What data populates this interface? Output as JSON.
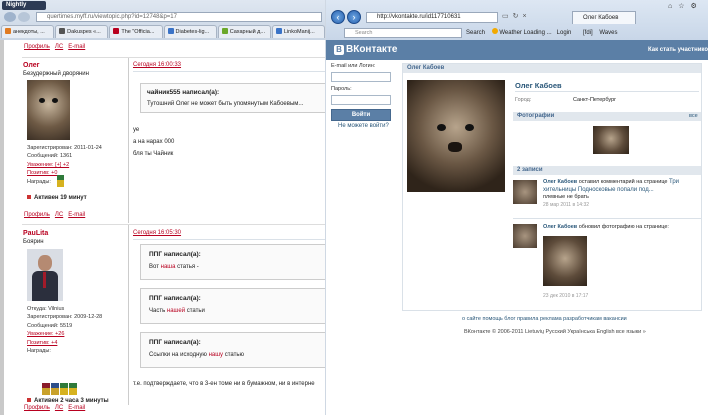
{
  "left_browser": {
    "app_menu": "Nightly",
    "address": "quertimes.myff.ru/viewtopic.php?id=12748&p=17",
    "address_host": "myff.ru",
    "tabs": [
      {
        "label": "анекдоты, ...",
        "color": "#e07b22"
      },
      {
        "label": "Dakuspes «...",
        "color": "#555555"
      },
      {
        "label": "The \"Officia...",
        "color": "#b8001f"
      },
      {
        "label": "Diabetes-lig...",
        "color": "#3a73c7"
      },
      {
        "label": "Сахарный д...",
        "color": "#6ba82a"
      },
      {
        "label": "LinkoManij...",
        "color": "#3a73c7"
      }
    ],
    "post_links": {
      "profile": "Профиль",
      "pm": "ЛС",
      "email": "E-mail"
    },
    "post1": {
      "author": "Олег",
      "rank": "Безудержный дворянин",
      "date": "Сегодня 16:00:33",
      "meta": [
        "Зарегистрирован: 2011-01-24",
        "Сообщений: 1361",
        "Уважение: [+] +2",
        "Позитив: +0",
        "Награды:"
      ],
      "active": "Активен 19 минут",
      "quote_header": "чайник555 написал(а):",
      "quote_text": "Тутошний Олег не может быть упомянутым Кабоевым...",
      "lines": [
        "уе",
        "а на нарах 000",
        "бля  ты Чайник"
      ]
    },
    "post2": {
      "author": "PauLita",
      "rank": "Боярин",
      "date": "Сегодня 16:05:30",
      "meta": [
        "Откуда: Vilnius",
        "Зарегистрирован: 2009-12-28",
        "Сообщений: 5519",
        "Уважение: +26",
        "Позитив: +4",
        "Награды:"
      ],
      "active": "Активен 2 часа 3 минуты",
      "quotes": [
        {
          "header": "ППГ написал(а):",
          "pre": "Вот ",
          "red": "наша",
          "post": " статья -"
        },
        {
          "header": "ППГ написал(а):",
          "pre": "Часть ",
          "red": "нашей",
          "post": "  статьи"
        },
        {
          "header": "ППГ написал(а):",
          "pre": "Ссылки на исходную ",
          "red": "нашу",
          "post": " статью"
        }
      ],
      "text": "т.е. подтверждаете, что в 3-ен томе ни в бумажном, ни в интерне"
    }
  },
  "right_browser": {
    "address": "http://vkontakte.ru/id117710631",
    "tab_label": "Олег Кабоев",
    "search_placeholder": "Search",
    "toolbar": [
      "Search",
      "Weather Loading ...",
      "Login",
      "[fdi]",
      "Waves"
    ],
    "logo": "ВКонтакте",
    "join": "Как стать участнико",
    "login": {
      "email_label": "E-mail или Логин:",
      "password_label": "Пароль:",
      "button": "Войти",
      "forgot": "Не можете войти?"
    },
    "profile": {
      "header": "Олег Кабоев",
      "name": "Олег Кабоев",
      "city_label": "Город:",
      "city": "Санкт-Петербург",
      "photos_header": "Фотографии",
      "photos_all": "все",
      "wall_header": "2 записи",
      "wall": [
        {
          "author": "Олег Кабоев",
          "text": " оставил комментарий на странице ",
          "link": "Три хительницы Подносковые попали под...",
          "extra": "плевные не брать",
          "date": "28 мар 2011 в 14:32"
        },
        {
          "author": "Олег Кабоев",
          "text": " обновил фотографию на странице:",
          "link": "",
          "extra": "",
          "date": "23 дек 2010 в 17:17"
        }
      ]
    },
    "footer_links": "о сайте   помощь   блог   правила   реклама   разработчикам   вакансии",
    "footer_copy": "ВКонтакте © 2006-2011  Lietuvių  Русский  Українська  English  все языки »"
  }
}
